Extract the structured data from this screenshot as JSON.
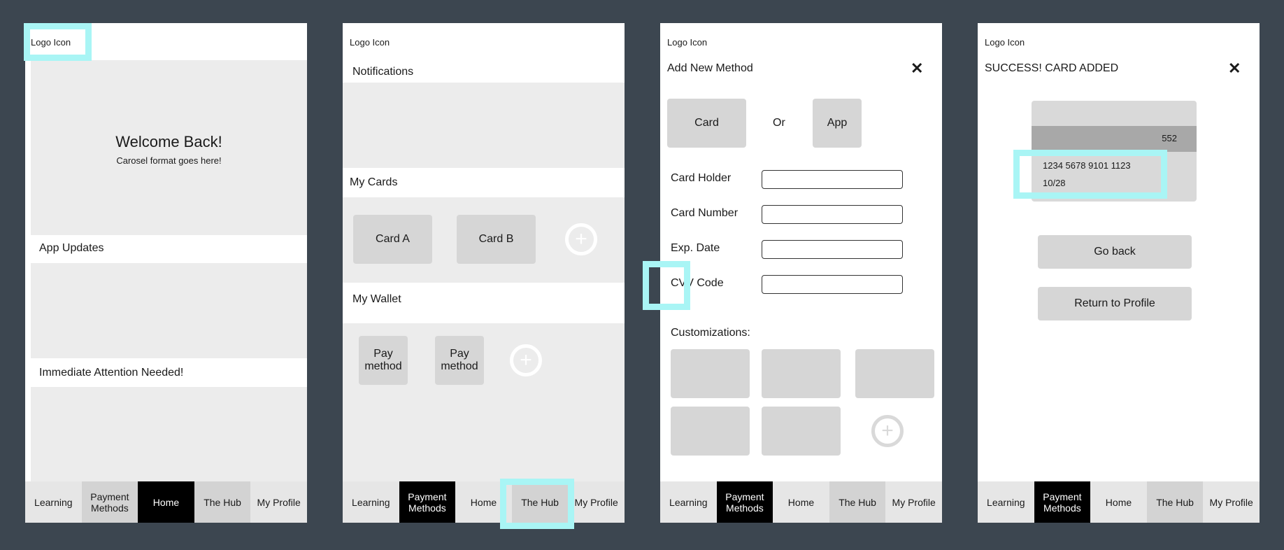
{
  "logo_text": "Logo Icon",
  "nav": {
    "items": [
      "Learning",
      "Payment\nMethods",
      "Home",
      "The Hub",
      "My Profile"
    ]
  },
  "screen1": {
    "welcome_title": "Welcome Back!",
    "welcome_sub": "Carosel format goes here!",
    "app_updates": "App Updates",
    "attention": "Immediate Attention Needed!"
  },
  "screen2": {
    "notifications": "Notifications",
    "my_cards": "My Cards",
    "card_a": "Card A",
    "card_b": "Card B",
    "my_wallet": "My Wallet",
    "pay_method": "Pay method"
  },
  "screen3": {
    "title": "Add New Method",
    "close": "✕",
    "card_btn": "Card",
    "or": "Or",
    "app_btn": "App",
    "card_holder": "Card Holder",
    "card_number": "Card Number",
    "exp_date": "Exp. Date",
    "cvv_code": "CVV Code",
    "customizations": "Customizations:"
  },
  "screen4": {
    "title": "SUCCESS! CARD ADDED",
    "close": "✕",
    "card_cvv": "552",
    "card_number": "1234 5678 9101 1123",
    "card_exp": "10/28",
    "go_back": "Go back",
    "return_profile": "Return to Profile"
  },
  "colors": {
    "background": "#3c4650",
    "highlight": "#a9f5f5",
    "active_nav": "#000000"
  },
  "icons": [
    "plus-circle-icon",
    "close-icon"
  ]
}
